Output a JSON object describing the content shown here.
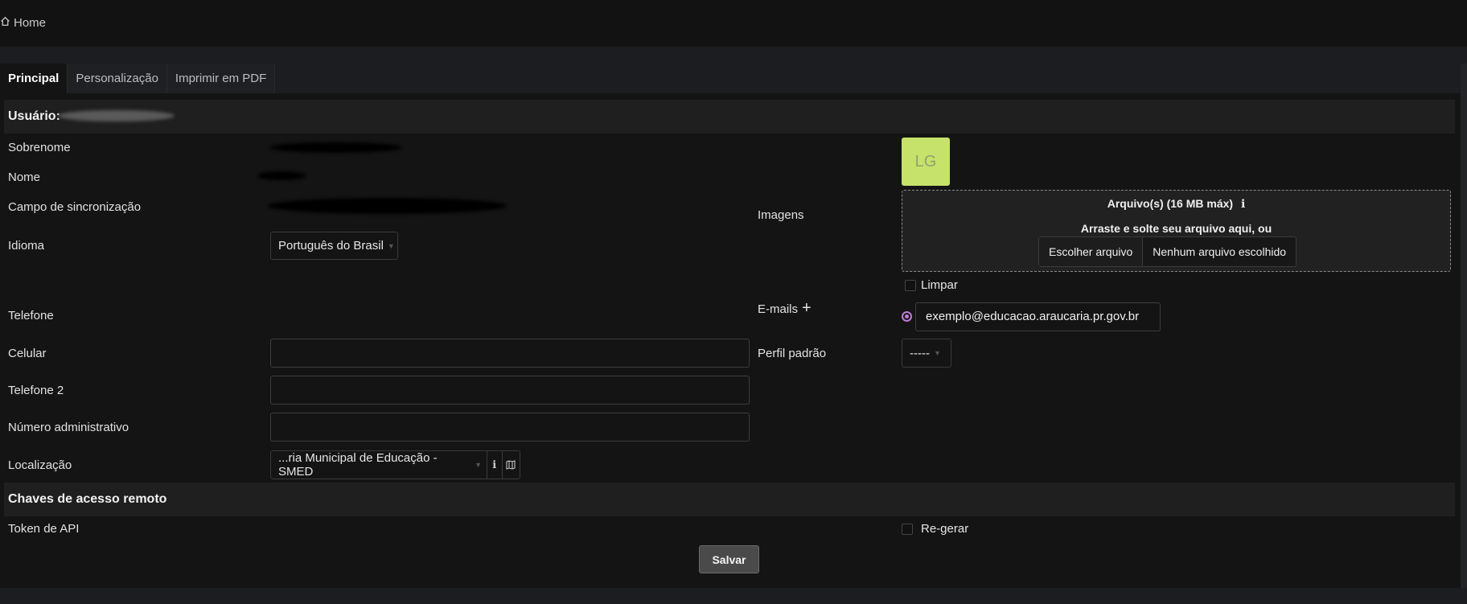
{
  "breadcrumb": {
    "home_label": "Home"
  },
  "tabs": [
    {
      "label": "Principal"
    },
    {
      "label": "Personalização"
    },
    {
      "label": "Imprimir em PDF"
    }
  ],
  "user_section": {
    "title": "Usuário:"
  },
  "fields": {
    "sobrenome": "Sobrenome",
    "nome": "Nome",
    "campo_sincronizacao": "Campo de sincronização",
    "idioma": "Idioma",
    "telefone": "Telefone",
    "celular": "Celular",
    "telefone2": "Telefone 2",
    "numero_admin": "Número administrativo",
    "localizacao": "Localização"
  },
  "idioma_select": {
    "value": "Português do Brasil"
  },
  "localizacao_select": {
    "value": "...ria Municipal de Educação - SMED"
  },
  "right": {
    "avatar_initials": "LG",
    "avatar_color": "#c6e26b",
    "imagens_label": "Imagens",
    "upload_title": "Arquivo(s) (16 MB máx)",
    "upload_hint": "Arraste e solte seu arquivo aqui, ou",
    "choose_file": "Escolher arquivo",
    "no_file": "Nenhum arquivo escolhido",
    "limpar": "Limpar",
    "emails_label": "E-mails",
    "email_value": "exemplo@educacao.araucaria.pr.gov.br",
    "perfil_label": "Perfil padrão",
    "perfil_value": "-----"
  },
  "remote_section": {
    "title": "Chaves de acesso remoto"
  },
  "token": {
    "label": "Token de API",
    "regerar": "Re-gerar"
  },
  "save_label": "Salvar"
}
